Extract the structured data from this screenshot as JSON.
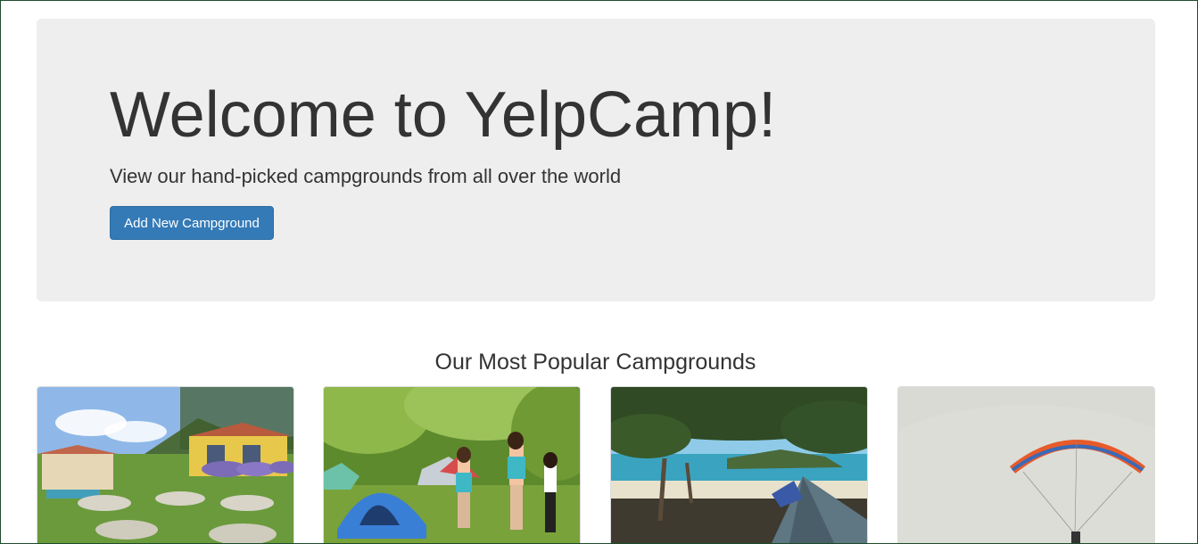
{
  "jumbotron": {
    "title": "Welcome to YelpCamp!",
    "subtitle": "View our hand-picked campgrounds from all over the world",
    "button_label": "Add New Campground",
    "button_color": "#337ab7",
    "background_color": "#eeeeee"
  },
  "section": {
    "title": "Our Most Popular Campgrounds"
  },
  "campgrounds": [
    {
      "image": "resort-picnic-area-photo"
    },
    {
      "image": "forest-tents-people-photo"
    },
    {
      "image": "beach-tent-trees-photo"
    },
    {
      "image": "paraglider-sky-photo"
    }
  ]
}
